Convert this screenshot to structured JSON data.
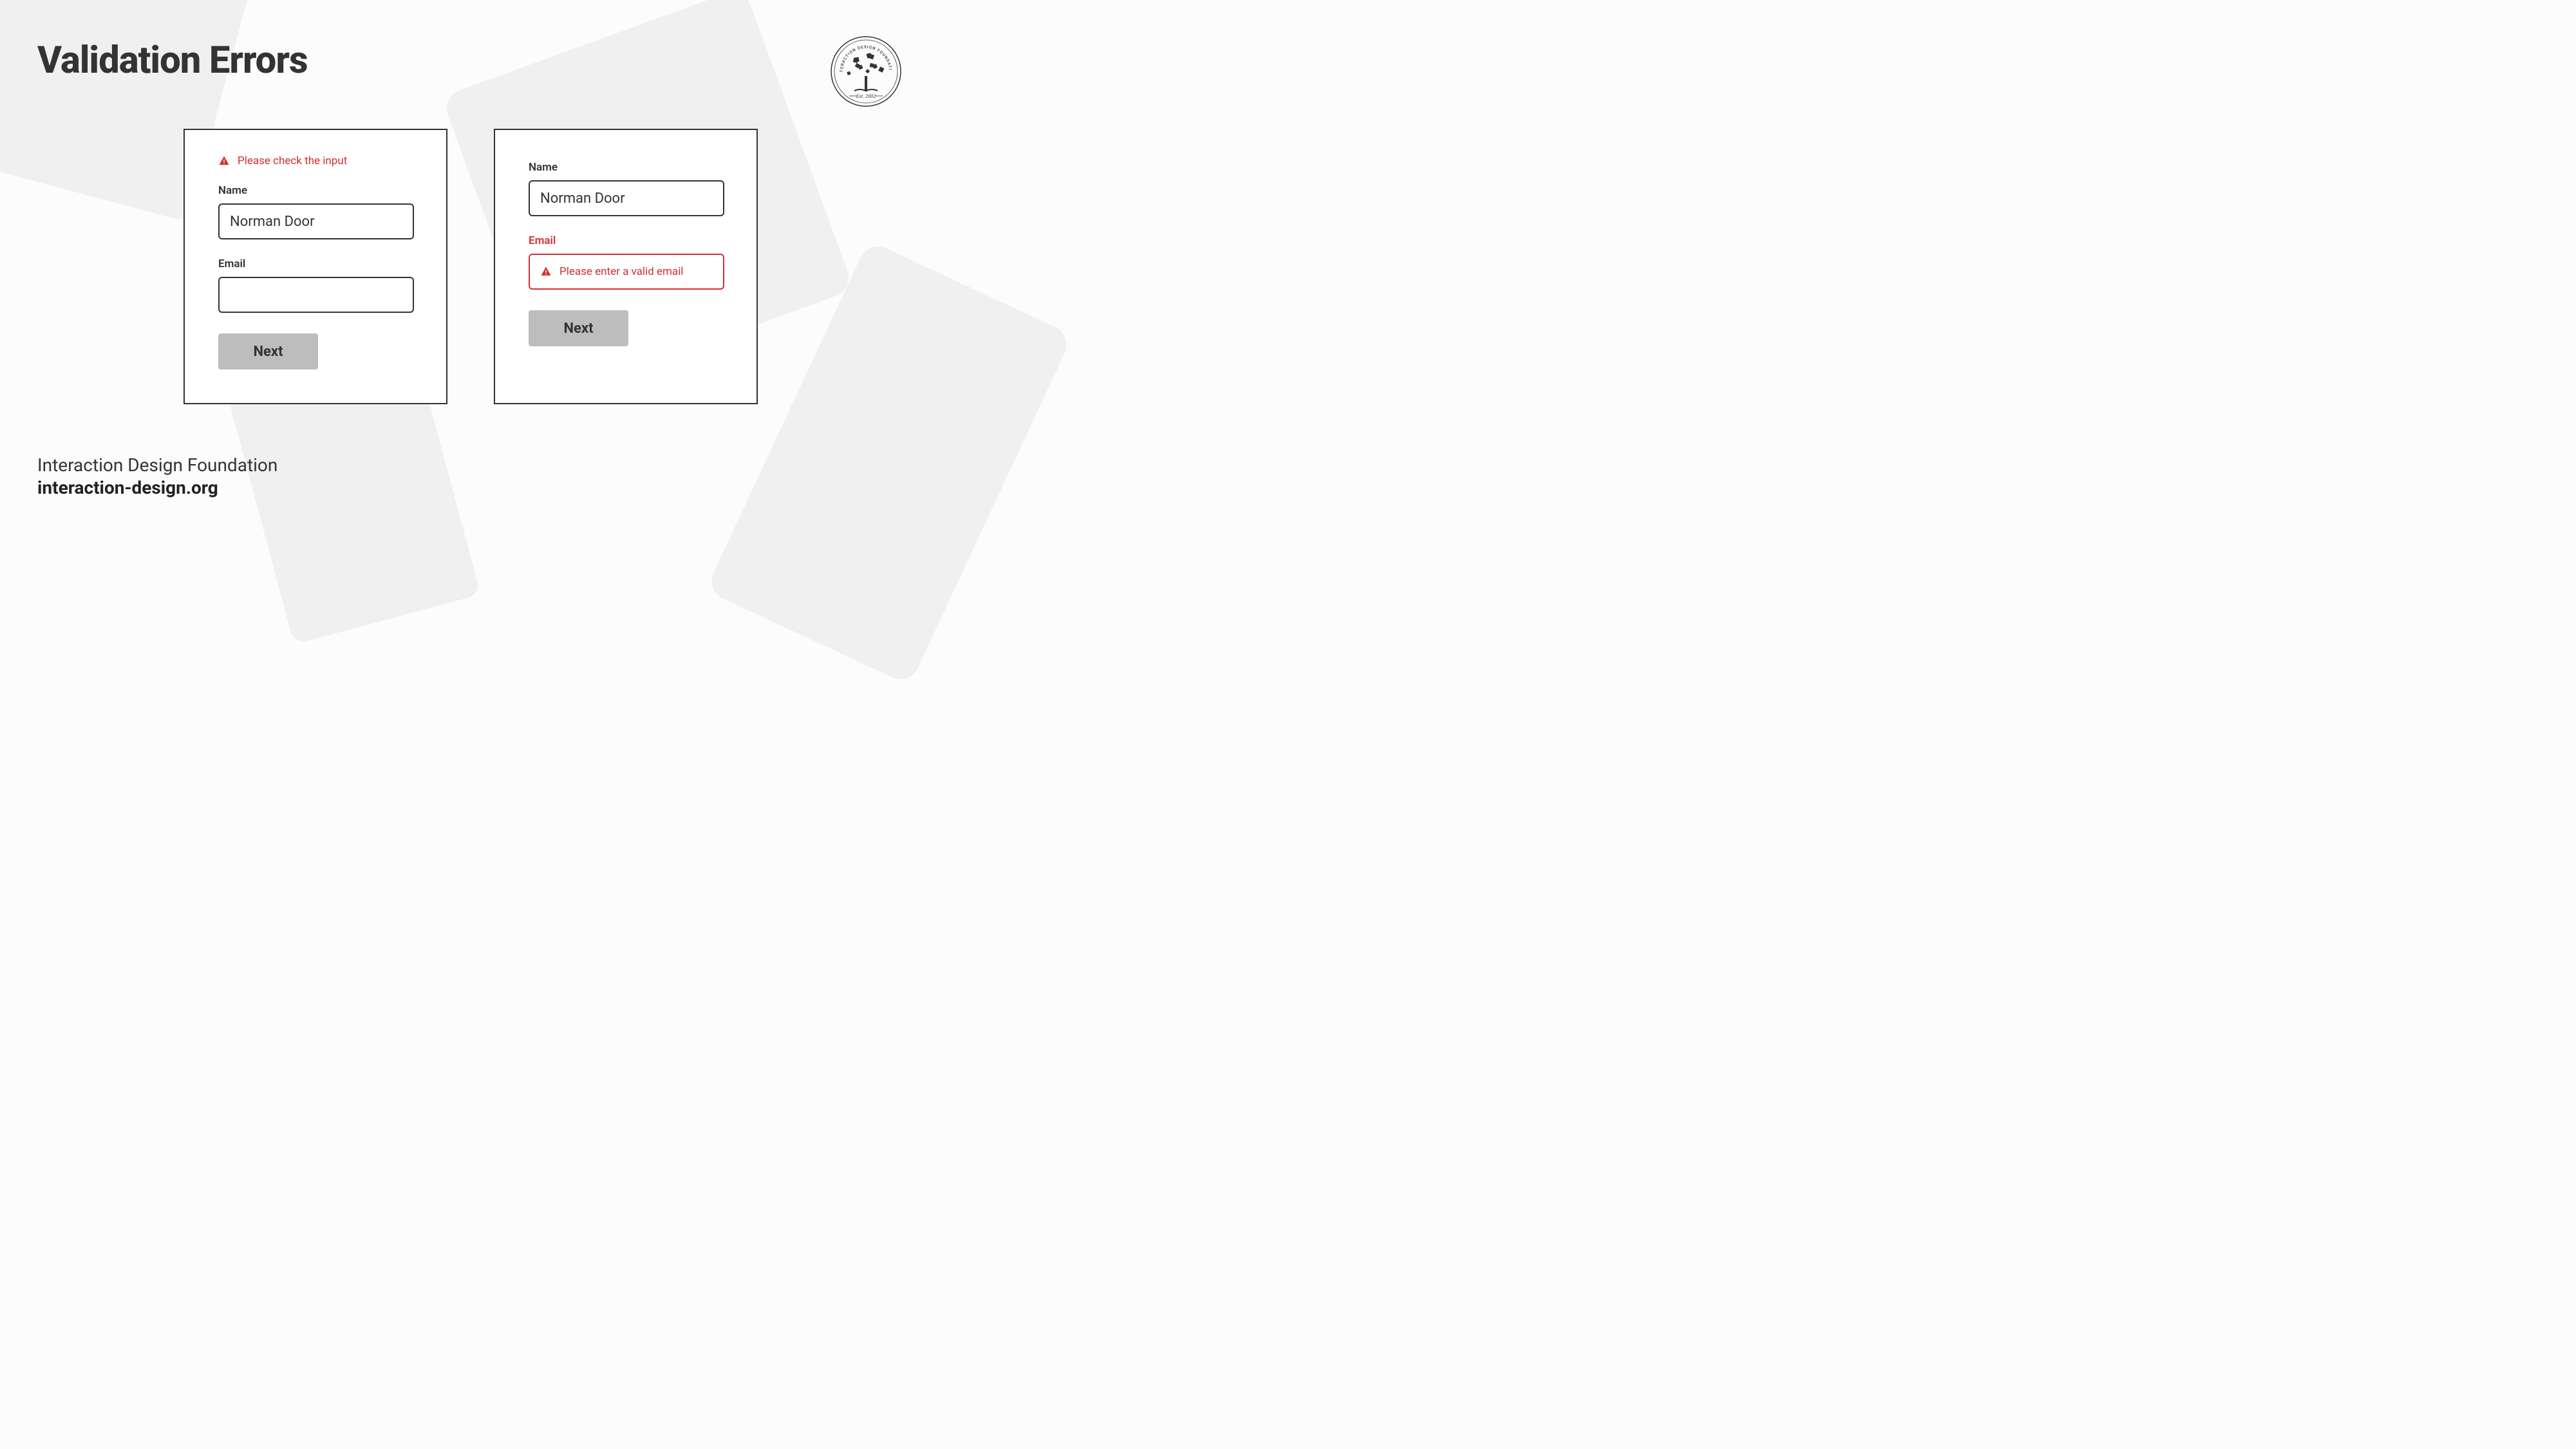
{
  "title": "Validation Errors",
  "logo": {
    "org_text": "INTERACTION DESIGN FOUNDATION",
    "est_text": "Est. 2002"
  },
  "forms": {
    "left": {
      "error_message": "Please check the input",
      "name_label": "Name",
      "name_value": "Norman Door",
      "email_label": "Email",
      "email_value": "",
      "button_label": "Next"
    },
    "right": {
      "name_label": "Name",
      "name_value": "Norman Door",
      "email_label": "Email",
      "email_error_message": "Please enter a valid email",
      "button_label": "Next"
    }
  },
  "footer": {
    "org": "Interaction Design Foundation",
    "url": "interaction-design.org"
  },
  "colors": {
    "error": "#d32f2f",
    "text": "#333333",
    "button_bg": "#bdbdbd"
  }
}
